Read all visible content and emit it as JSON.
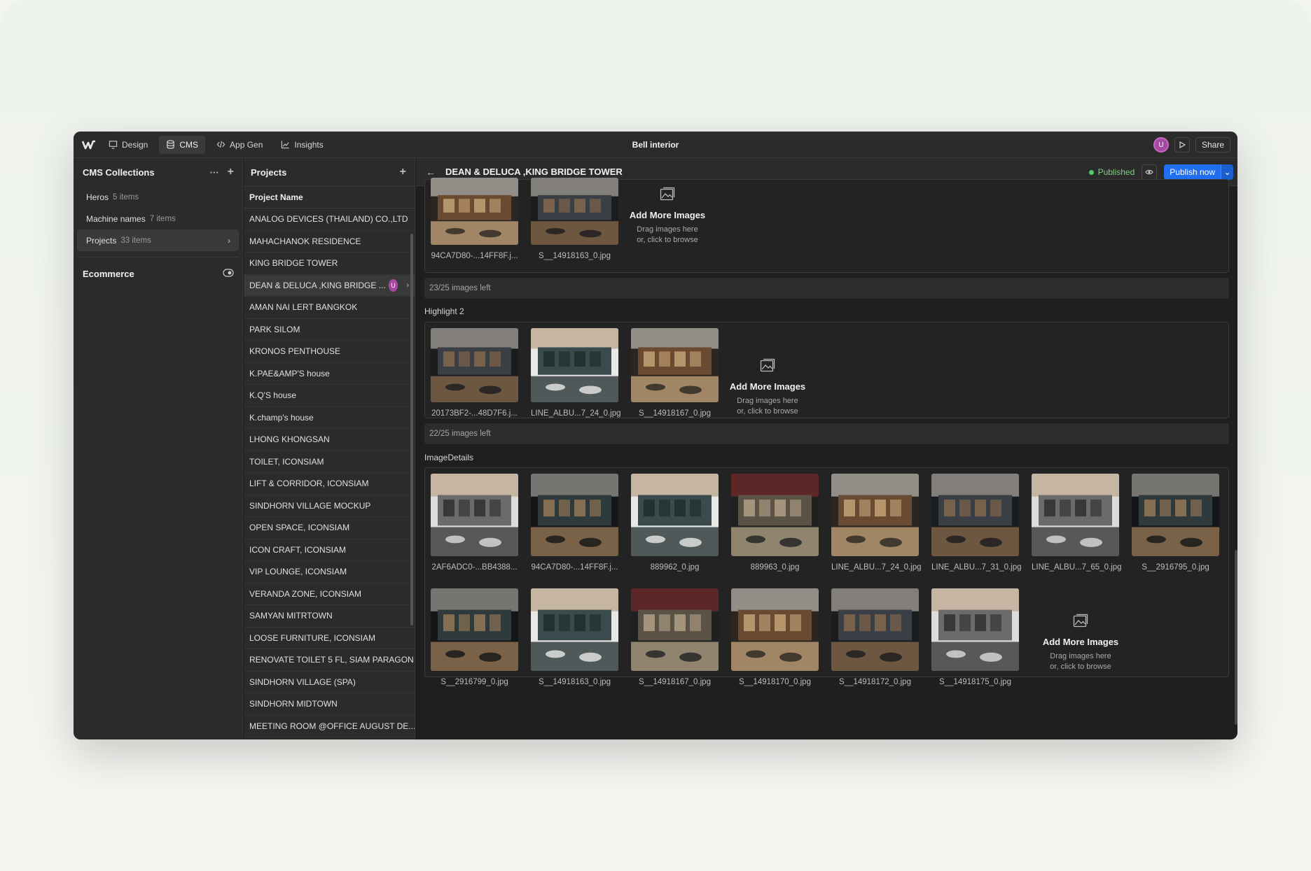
{
  "app": {
    "title": "Bell interior",
    "tabs": [
      {
        "label": "Design",
        "icon": "design-icon"
      },
      {
        "label": "CMS",
        "icon": "database-icon",
        "active": true
      },
      {
        "label": "App Gen",
        "icon": "code-icon"
      },
      {
        "label": "Insights",
        "icon": "chart-icon"
      }
    ],
    "avatar_initial": "U",
    "share_label": "Share"
  },
  "collections": {
    "header": "CMS Collections",
    "items": [
      {
        "name": "Heros",
        "count": "5 items"
      },
      {
        "name": "Machine names",
        "count": "7 items"
      },
      {
        "name": "Projects",
        "count": "33 items",
        "selected": true
      }
    ],
    "ecommerce_label": "Ecommerce"
  },
  "projects": {
    "header": "Projects",
    "column_header": "Project Name",
    "rows": [
      "ANALOG DEVICES (THAILAND) CO.,LTD",
      "MAHACHANOK RESIDENCE",
      "KING BRIDGE TOWER",
      "DEAN & DELUCA ,KING BRIDGE ...",
      "AMAN NAI LERT BANGKOK",
      "PARK SILOM",
      "KRONOS PENTHOUSE",
      "K.PAE&AMP'S house",
      "K.Q'S house",
      "K.champ's house",
      "LHONG KHONGSAN",
      "TOILET, ICONSIAM",
      "LIFT & CORRIDOR, ICONSIAM",
      "SINDHORN VILLAGE MOCKUP",
      "OPEN SPACE, ICONSIAM",
      "ICON CRAFT, ICONSIAM",
      "VIP LOUNGE, ICONSIAM",
      "VERANDA ZONE, ICONSIAM",
      "SAMYAN MITRTOWN",
      "LOOSE FURNITURE, ICONSIAM",
      "RENOVATE TOILET 5 FL, SIAM PARAGON",
      "SINDHORN VILLAGE (SPA)",
      "SINDHORN MIDTOWN",
      "MEETING ROOM @OFFICE AUGUST DE..."
    ],
    "selected_index": 3,
    "selected_avatar": "U"
  },
  "editor": {
    "item_title": "DEAN & DELUCA ,KING BRIDGE TOWER",
    "status": "Published",
    "publish_label": "Publish now",
    "add_more": {
      "title": "Add More Images",
      "line1": "Drag images here",
      "line2": "or, click to browse"
    },
    "field1": {
      "images": [
        "94CA7D80-...14FF8F.j...",
        "S__14918163_0.jpg"
      ],
      "left": "23/25 images left"
    },
    "field2": {
      "label": "Highlight 2",
      "images": [
        "20173BF2-...48D7F6.j...",
        "LINE_ALBU...7_24_0.jpg",
        "S__14918167_0.jpg"
      ],
      "left": "22/25 images left"
    },
    "field3": {
      "label": "ImageDetails",
      "row1": [
        "2AF6ADC0-...BB4388...",
        "94CA7D80-...14FF8F.j...",
        "889962_0.jpg",
        "889963_0.jpg",
        "LINE_ALBU...7_24_0.jpg",
        "LINE_ALBU...7_31_0.jpg",
        "LINE_ALBU...7_65_0.jpg",
        "S__2916795_0.jpg"
      ],
      "row2": [
        "S__2916799_0.jpg",
        "S__14918163_0.jpg",
        "S__14918167_0.jpg",
        "S__14918170_0.jpg",
        "S__14918172_0.jpg",
        "S__14918175_0.jpg"
      ]
    }
  }
}
